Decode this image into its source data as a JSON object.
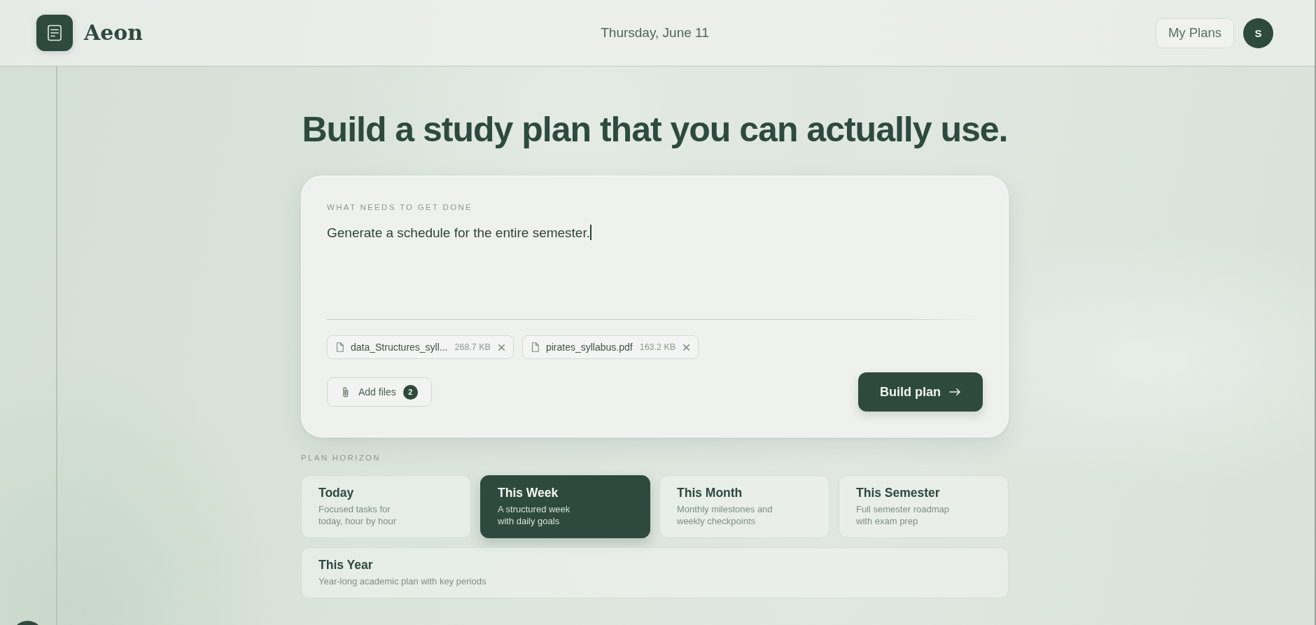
{
  "header": {
    "app_name": "Aeon",
    "date": "Thursday, June 11",
    "my_plans": "My Plans",
    "avatar_initial": "S"
  },
  "headline": "Build a study plan that you can actually use.",
  "task_card": {
    "label": "WHAT NEEDS TO GET DONE",
    "input_value": "Generate a schedule for the entire semester.",
    "focused": true,
    "attachments": [
      {
        "name": "data_Structures_syll...",
        "size": "268.7 KB"
      },
      {
        "name": "pirates_syllabus.pdf",
        "size": "163.2 KB"
      }
    ],
    "add_files": {
      "label": "Add files",
      "count": "2"
    },
    "build_button": "Build plan"
  },
  "plan_horizon": {
    "label": "PLAN HORIZON",
    "options": [
      {
        "title": "Today",
        "description": "Focused tasks for\ntoday, hour by hour",
        "selected": false
      },
      {
        "title": "This Week",
        "description": "A structured week\nwith daily goals",
        "selected": true
      },
      {
        "title": "This Month",
        "description": "Monthly milestones and\nweekly checkpoints",
        "selected": false
      },
      {
        "title": "This Semester",
        "description": "Full semester roadmap\nwith exam prep",
        "selected": false
      },
      {
        "title": "This Year",
        "description": "Year-long academic plan with key periods",
        "selected": false
      }
    ]
  }
}
